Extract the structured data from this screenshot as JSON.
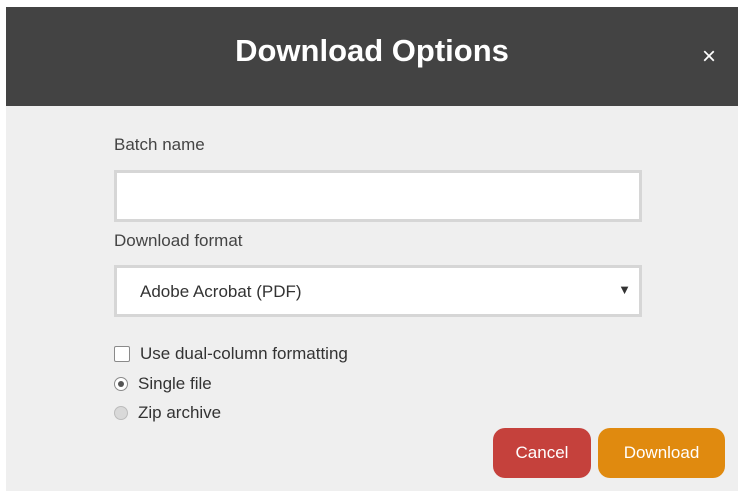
{
  "dialog": {
    "title": "Download Options",
    "close_symbol": "×",
    "batch_name": {
      "label": "Batch name",
      "value": "",
      "placeholder": ""
    },
    "download_format": {
      "label": "Download format",
      "selected": "Adobe Acrobat (PDF)",
      "arrow_symbol": "▼"
    },
    "options": {
      "dual_column": {
        "label": "Use dual-column formatting",
        "checked": false
      },
      "single_file": {
        "label": "Single file",
        "checked": true
      },
      "zip_archive": {
        "label": "Zip archive",
        "checked": false
      }
    },
    "buttons": {
      "cancel": "Cancel",
      "download": "Download"
    },
    "colors": {
      "header": "#434343",
      "body": "#efefef",
      "cancel": "#c5413c",
      "download": "#e08a0f"
    }
  }
}
